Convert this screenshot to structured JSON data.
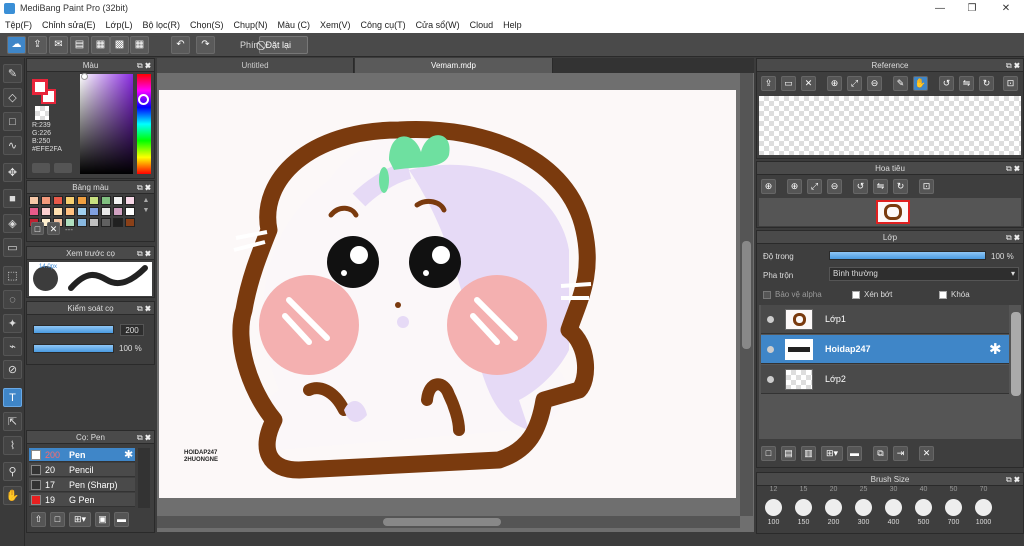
{
  "app": {
    "title": "MediBang Paint Pro (32bit)"
  },
  "window": {
    "minimize": "—",
    "restore": "❐",
    "close": "✕"
  },
  "menu": [
    "Tệp(F)",
    "Chỉnh sửa(E)",
    "Lớp(L)",
    "Bộ lọc(R)",
    "Chọn(S)",
    "Chụp(N)",
    "Màu (C)",
    "Xem(V)",
    "Công cụ(T)",
    "Cửa sổ(W)",
    "Cloud",
    "Help"
  ],
  "toolbar": {
    "shortcut_label": "Phím",
    "reset_label": "Đặt lại"
  },
  "tabs": [
    "Untitled",
    "Vemam.mdp"
  ],
  "color_panel": {
    "title": "Màu",
    "r": "R:239",
    "g": "G:226",
    "b": "B:250",
    "hex": "#EFE2FA",
    "fg_color": "#e8243a",
    "bg_color": "#ffffff"
  },
  "palette_panel": {
    "title": "Bảng màu",
    "dots": "---",
    "colors": [
      "#f7c8a8",
      "#f49a7c",
      "#e85a4a",
      "#f7d070",
      "#f0a040",
      "#c8e080",
      "#80c080",
      "#f2f2f2",
      "#f8d8e8",
      "#e85a8a",
      "#fcd0d0",
      "#ffe0b0",
      "#ffc080",
      "#a0d0f0",
      "#80a0e0",
      "#e8e8e8",
      "#d0a0c0",
      "#ffffff",
      "#c02030",
      "#fff0d0",
      "#f0c0a0",
      "#b0e0c0",
      "#88b8e0",
      "#c0c0c0",
      "#606060",
      "#202020",
      "#8a4018"
    ]
  },
  "preview_panel": {
    "title": "Xem trước cọ",
    "size": "14.0px"
  },
  "control_panel": {
    "title": "Kiểm soát cọ",
    "size_value": "200",
    "opacity_value": "100 %"
  },
  "brush_panel": {
    "title": "Cọ: Pen",
    "items": [
      {
        "size": "200",
        "name": "Pen",
        "color": "#ffffff",
        "selected": true
      },
      {
        "size": "20",
        "name": "Pencil",
        "color": "#333333",
        "selected": false
      },
      {
        "size": "17",
        "name": "Pen (Sharp)",
        "color": "#333333",
        "selected": false
      },
      {
        "size": "19",
        "name": "G Pen",
        "color": "#e82020",
        "selected": false
      }
    ]
  },
  "reference_panel": {
    "title": "Reference"
  },
  "navigator_panel": {
    "title": "Hoa tiêu"
  },
  "layer_panel": {
    "title": "Lớp",
    "opacity_label": "Độ trong",
    "opacity_value": "100 %",
    "opacity": 1.0,
    "blend_label": "Pha trộn",
    "blend_value": "Bình thường",
    "protect_alpha": "Bảo vệ alpha",
    "clipping": "Xén bớt",
    "lock": "Khóa",
    "layers": [
      {
        "name": "Lớp1",
        "selected": false
      },
      {
        "name": "Hoidap247",
        "selected": true
      },
      {
        "name": "Lớp2",
        "selected": false
      }
    ]
  },
  "brush_size_panel": {
    "title": "Brush Size",
    "top_sizes": [
      "12",
      "15",
      "20",
      "25",
      "30",
      "40",
      "50",
      "70"
    ],
    "bottom_sizes": [
      "100",
      "150",
      "200",
      "300",
      "400",
      "500",
      "700",
      "1000"
    ]
  },
  "artwork": {
    "signature_line1": "HOIDAP247",
    "signature_line2": "2HUONGNE",
    "outline_color": "#7a3a0e",
    "sprout_color": "#6ee0a0",
    "blush_color": "#f4b0b0",
    "shade_color": "#e6daf6"
  }
}
